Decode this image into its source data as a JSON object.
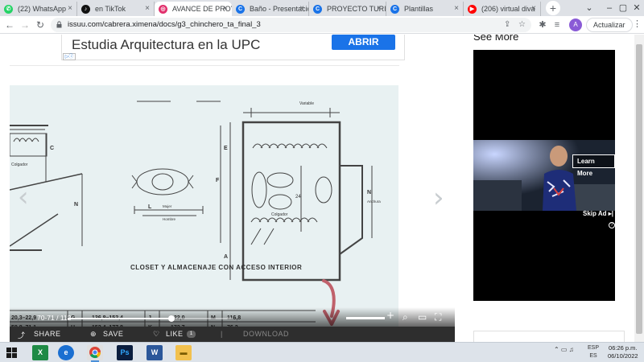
{
  "browser": {
    "tabs": [
      {
        "title": "(22) WhatsApp",
        "color": "#25d366",
        "glyph": "✆"
      },
      {
        "title": "en TikTok",
        "color": "#111111",
        "glyph": "♪"
      },
      {
        "title": "AVANCE DE PROY",
        "color": "#e1306c",
        "glyph": "◎",
        "active": true
      },
      {
        "title": "Baño - Presentacio",
        "color": "#1a73e8",
        "glyph": "C"
      },
      {
        "title": "PROYECTO TURIS",
        "color": "#1a73e8",
        "glyph": "C"
      },
      {
        "title": "Plantillas",
        "color": "#1a73e8",
        "glyph": "C"
      },
      {
        "title": "(206) virtual diva",
        "color": "#ff0000",
        "glyph": "▶"
      }
    ],
    "new_tab": "+",
    "url": "issuu.com/cabrera.ximena/docs/g3_chinchero_ta_final_3",
    "update_label": "Actualizar",
    "avatar_letter": "A"
  },
  "ad_top": {
    "headline": "Estudia Arquitectura en la UPC",
    "button": "ABRIR"
  },
  "drawing": {
    "caption": "CLOSET Y ALMACENAJE CON ACCESO INTERIOR",
    "labels": {
      "variable": "Variable",
      "colgador_left": "Colgador",
      "colgador_center": "Colgador",
      "mujer": "Mujer",
      "hombre": "Hombre",
      "n_anchura": "Anchura",
      "dim_24": "24",
      "letter_c": "C",
      "letter_n": "N",
      "letter_l": "L",
      "letter_e": "E",
      "letter_f": "F",
      "letter_a": "A"
    },
    "table_rows": [
      [
        "20,3–22,9",
        "G",
        "136,8–152,4",
        "J",
        "122,0",
        "M",
        "116,8"
      ],
      [
        "50,8–71,1",
        "H",
        "152,4–177,8",
        "K",
        "172,7",
        "N",
        "76,2"
      ]
    ]
  },
  "viewer": {
    "page_indicator": "70-71 / 112",
    "progress_fraction": 0.63,
    "zoom_fraction": 1.0,
    "share": "SHARE",
    "save": "SAVE",
    "like": "LIKE",
    "like_count": "1",
    "download": "DOWNLOAD"
  },
  "sidebar": {
    "see_more": "See More",
    "learn_more": "Learn More",
    "skip_ad": "Skip Ad ▸|",
    "info": "?"
  },
  "taskbar": {
    "lang_top": "ESP",
    "lang_bottom": "ES",
    "time": "06:26 p.m.",
    "date": "06/10/2022"
  }
}
